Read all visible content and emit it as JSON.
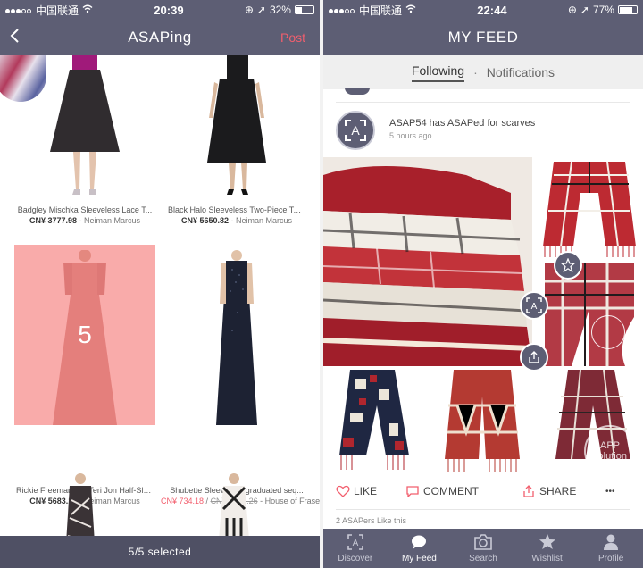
{
  "left": {
    "status": {
      "carrier": "中国联通",
      "time": "20:39",
      "battery": "32%",
      "battery_level": 0.32
    },
    "nav": {
      "back_icon": "chevron-left-icon",
      "title": "ASAPing",
      "post": "Post"
    },
    "products": [
      {
        "name": "Badgley Mischka Sleeveless Lace T...",
        "price": "CN¥ 3777.98",
        "store": " - Neiman Marcus",
        "color": "#1e1a1d",
        "top": "#a01a7a"
      },
      {
        "name": "Black Halo Sleeveless Two-Piece Tea...",
        "price": "CN¥ 5650.82",
        "store": " - Neiman Marcus",
        "color": "#1b1b1d",
        "top": "#1b1b1d"
      },
      {
        "name": "Rickie Freeman For Teri Jon Half-Sle...",
        "price": "CN¥ 5683.11",
        "store": " - Neiman Marcus",
        "color": "#c98b86",
        "top": "#c98b86"
      },
      {
        "name": "Shubette Sleeveless graduated seq...",
        "sale_price": "CN¥ 734.18",
        "slash": " / ",
        "orig_price": "CN¥ 2447.26",
        "store": " - House of Fraser",
        "color": "#1d2233",
        "top": "#1d2233"
      }
    ],
    "selected_number": "5",
    "selection_bar": "5/5 selected"
  },
  "right": {
    "status": {
      "carrier": "中国联通",
      "time": "22:44",
      "battery": "77%",
      "battery_level": 0.77
    },
    "nav": {
      "title": "MY FEED"
    },
    "tabs": {
      "following": "Following",
      "separator": "·",
      "notifications": "Notifications"
    },
    "post": {
      "avatar_letter": "A",
      "title": "ASAP54 has ASAPed for scarves",
      "time": "5 hours ago"
    },
    "actions": {
      "like": "LIKE",
      "comment": "COMMENT",
      "share": "SHARE",
      "more": "•••"
    },
    "likes_text": "2 ASAPers Like this",
    "watermark": "APP solution",
    "tabbar": [
      {
        "label": "Discover",
        "icon": "asap-logo-icon",
        "active": false
      },
      {
        "label": "My Feed",
        "icon": "chat-bubble-icon",
        "active": true
      },
      {
        "label": "Search",
        "icon": "camera-icon",
        "active": false
      },
      {
        "label": "Wishlist",
        "icon": "star-icon",
        "active": false
      },
      {
        "label": "Profile",
        "icon": "person-icon",
        "active": false
      }
    ]
  },
  "colors": {
    "header": "#5d5e74",
    "accent": "#f25f6e",
    "selection_overlay": "#f67876"
  }
}
